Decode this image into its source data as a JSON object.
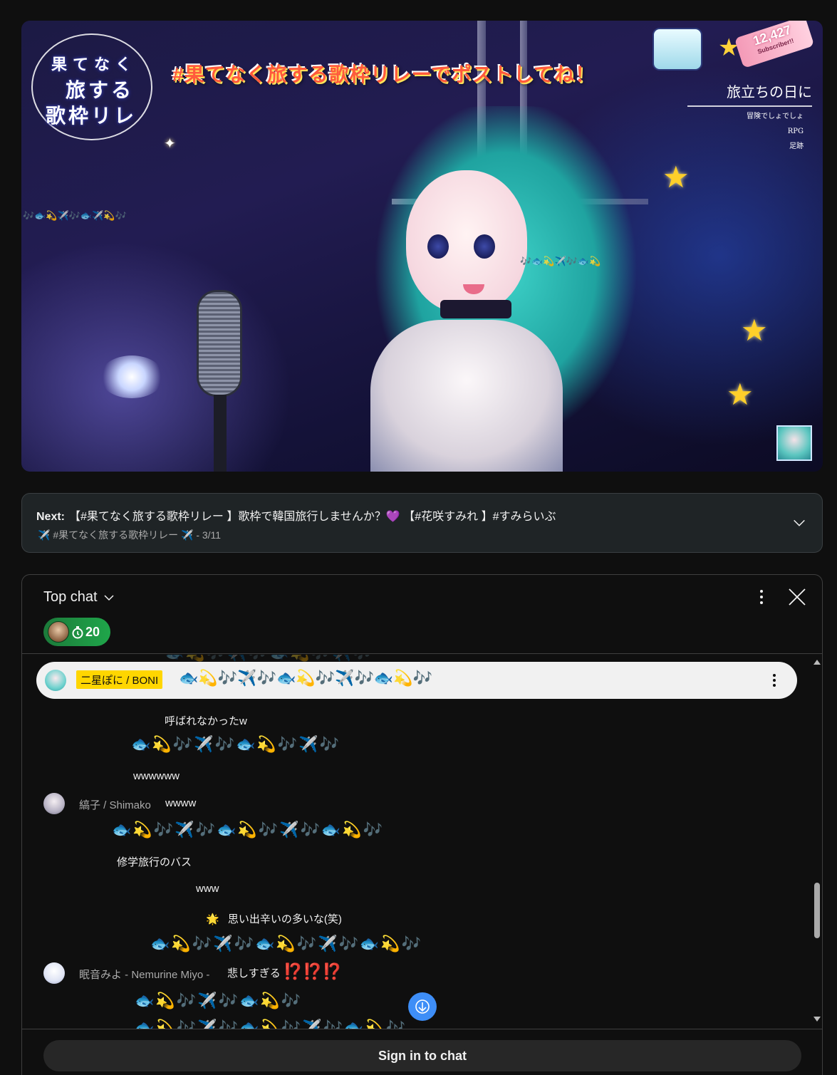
{
  "video": {
    "logo_line1": "果てなく",
    "logo_line2": "旅する",
    "logo_line3": "歌枠リレ",
    "banner": "#果てなく旅する歌枠リレーでポストしてね！",
    "subscriber_count": "12,427",
    "subscriber_label": "Subscriber!!",
    "song_title": "旅立ちの日に",
    "song_list": [
      "冒険でしょでしょ",
      "RPG",
      "足跡"
    ],
    "overlay_emoji_1": "🎶🐟💫✈️🎶🐟✈️💫🎶",
    "overlay_emoji_2": "🎶🐟💫✈️🎶🐟💫"
  },
  "next": {
    "label": "Next:",
    "title": "【#果てなく旅する歌枠リレー 】歌枠で韓国旅行しませんか？💜 【#花咲すみれ 】#すみらいぶ",
    "playlist": "✈️ #果てなく旅する歌枠リレー ✈️ - 3/11"
  },
  "chat": {
    "mode_label": "Top chat",
    "gift_count": "20",
    "pinned": {
      "author": "二星ぽに / BONI",
      "message": "🐟💫🎶✈️🎶🐟💫🎶✈️🎶🐟💫🎶"
    },
    "messages": {
      "m1": "呼ばれなかったw",
      "m2": "🐟💫🎶✈️🎶🐟💫🎶✈️🎶",
      "m3": "wwwwww",
      "m4_author": "縞子 / Shimako",
      "m4_text": "wwww",
      "m5": "🐟💫🎶✈️🎶🐟💫🎶✈️🎶🐟💫🎶",
      "m6": "修学旅行のバス",
      "m7": "www",
      "m8_prefix": "🌟",
      "m8": "思い出辛いの多いな(笑)",
      "m9": "🐟💫🎶✈️🎶🐟💫🎶✈️🎶🐟💫🎶",
      "m10_author": "眠音みよ - Nemurine Miyo -",
      "m10_text": "悲しすぎる",
      "m10_bangs": "⁉️⁉️⁉️",
      "m11": "🐟💫🎶✈️🎶🐟💫🎶",
      "m12": "🐟💫🎶✈️🎶🐟💫🎶✈️🎶🐟💫🎶"
    },
    "signin_label": "Sign in to chat"
  },
  "colors": {
    "background": "#0f0f0f",
    "pinned_bg": "#f1f1f1",
    "owner_badge": "#ffd600",
    "gift_green": "#1fa64a",
    "scroll_button": "#3e8ef7"
  },
  "icons": [
    "chevron-down-icon",
    "more-vert-icon",
    "close-icon",
    "gift-icon",
    "arrow-down-icon",
    "scroll-up-icon",
    "scroll-down-icon"
  ]
}
